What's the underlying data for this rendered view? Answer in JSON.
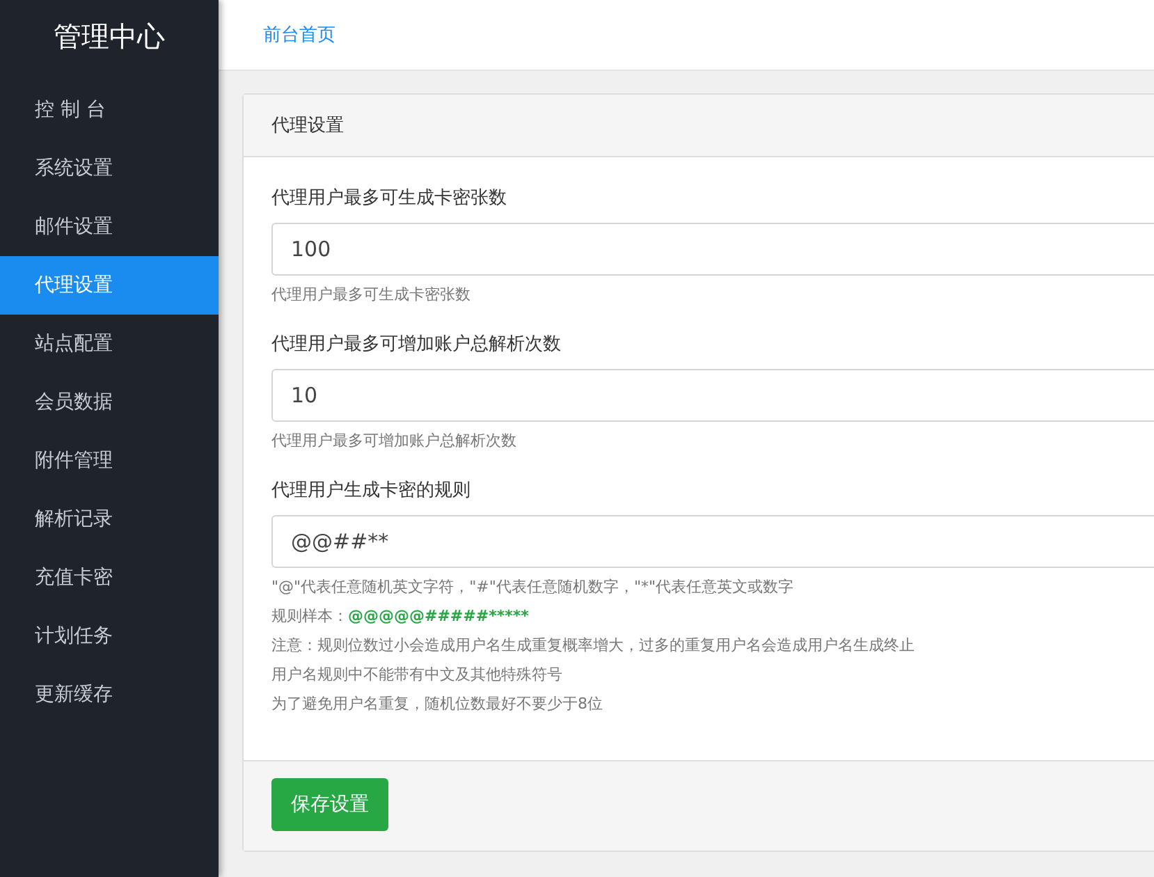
{
  "sidebar": {
    "title": "管理中心",
    "items": [
      {
        "label": "控 制 台",
        "selected": false
      },
      {
        "label": "系统设置",
        "selected": false
      },
      {
        "label": "邮件设置",
        "selected": false
      },
      {
        "label": "代理设置",
        "selected": true
      },
      {
        "label": "站点配置",
        "selected": false
      },
      {
        "label": "会员数据",
        "selected": false
      },
      {
        "label": "附件管理",
        "selected": false
      },
      {
        "label": "解析记录",
        "selected": false
      },
      {
        "label": "充值卡密",
        "selected": false
      },
      {
        "label": "计划任务",
        "selected": false
      },
      {
        "label": "更新缓存",
        "selected": false
      }
    ]
  },
  "topbar": {
    "link": "前台首页"
  },
  "card": {
    "title": "代理设置",
    "fields": [
      {
        "label": "代理用户最多可生成卡密张数",
        "value": "100",
        "help": [
          {
            "kind": "plain",
            "text": "代理用户最多可生成卡密张数"
          }
        ]
      },
      {
        "label": "代理用户最多可增加账户总解析次数",
        "value": "10",
        "help": [
          {
            "kind": "plain",
            "text": "代理用户最多可增加账户总解析次数"
          }
        ]
      },
      {
        "label": "代理用户生成卡密的规则",
        "value": "@@##**",
        "help": [
          {
            "kind": "plain",
            "text": "\"@\"代表任意随机英文字符，\"#\"代表任意随机数字，\"*\"代表任意英文或数字"
          },
          {
            "kind": "sample",
            "text": "规则样本：",
            "sample": "@@@@@#####*****"
          },
          {
            "kind": "plain",
            "text": "注意：规则位数过小会造成用户名生成重复概率增大，过多的重复用户名会造成用户名生成终止"
          },
          {
            "kind": "plain",
            "text": "用户名规则中不能带有中文及其他特殊符号"
          },
          {
            "kind": "plain",
            "text": "为了避免用户名重复，随机位数最好不要少于8位"
          }
        ]
      }
    ],
    "save_button": "保存设置"
  }
}
